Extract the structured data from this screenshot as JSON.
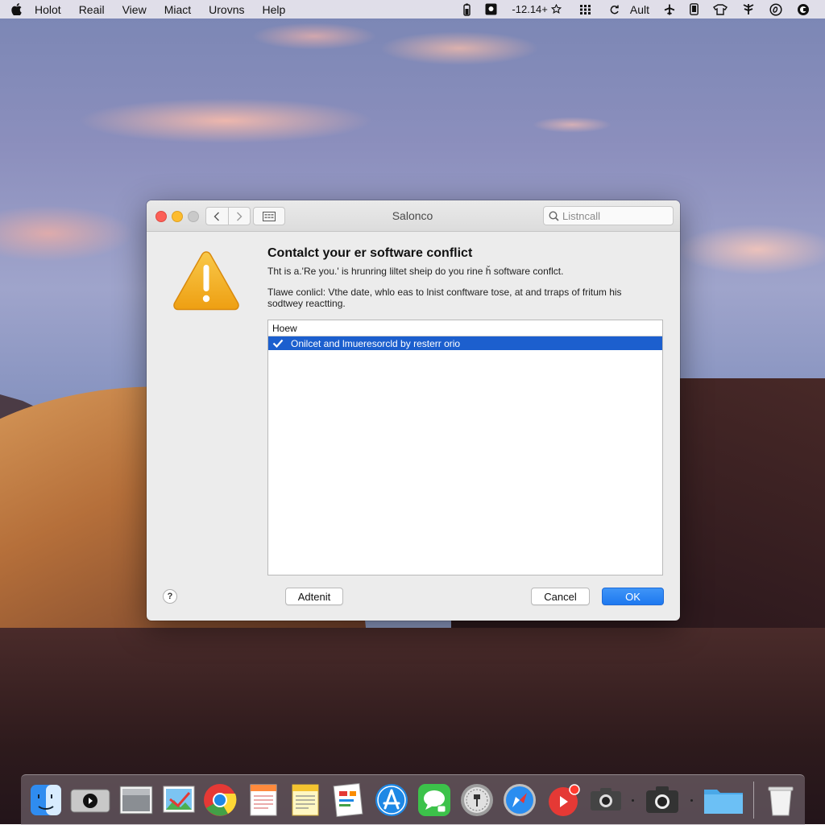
{
  "menubar": {
    "items": [
      "Holot",
      "Reail",
      "View",
      "Miact",
      "Urovns",
      "Help"
    ],
    "clock": "-12.14+",
    "user": "Ault"
  },
  "window": {
    "title": "Salonco",
    "search_placeholder": "Listncall",
    "heading": "Contalct your er software conflict",
    "line1": "Tht is a.'Re you.' is hrunring liltet sheip do you rine ȟ software conflct.",
    "line2": "Tlawe conlicl: Vthe date, whlo eas to lnist conftware tose, at and trraps of fritum his sodtwey reactting.",
    "list": {
      "header": "Hoew",
      "items": [
        {
          "label": "Onilcet and lmueresorcld by resterr orio",
          "selected": true,
          "checked": true
        }
      ]
    },
    "buttons": {
      "help": "?",
      "adtenit": "Adtenit",
      "cancel": "Cancel",
      "ok": "OK"
    }
  },
  "colors": {
    "accent": "#1c5fce",
    "ok_button": "#2a84f4",
    "warning": "#f4b11e"
  },
  "dock": {
    "icons": [
      "finder-icon",
      "quicktime-icon",
      "preview-icon",
      "photo-icon",
      "chrome-icon",
      "notes-icon",
      "stickies-icon",
      "keynote-icon",
      "app-store-icon",
      "messages-icon",
      "disk-utility-icon",
      "safari-icon",
      "media-icon",
      "screenshot-icon",
      "camera-icon",
      "folder-icon",
      "trash-icon"
    ]
  }
}
